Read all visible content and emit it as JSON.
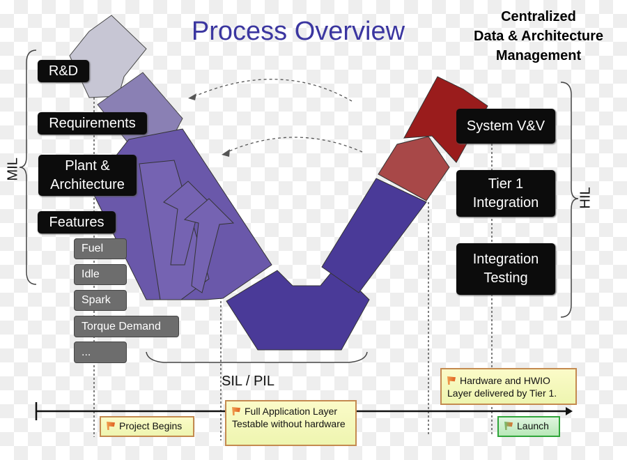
{
  "title": "Process Overview",
  "central_label": [
    "Centralized",
    "Data & Architecture",
    "Management"
  ],
  "left_stages": [
    "R&D",
    "Requirements",
    "Plant & Architecture",
    "Features"
  ],
  "features": [
    "Fuel",
    "Idle",
    "Spark",
    "Torque Demand",
    "..."
  ],
  "right_stages": [
    "System V&V",
    "Tier 1 Integration",
    "Integration Testing"
  ],
  "brackets": {
    "left": "MIL",
    "right": "HIL",
    "bottom": "SIL / PIL"
  },
  "milestones": {
    "project_begins": "Project Begins",
    "full_app": "Full Application Layer Testable without hardware",
    "hardware": "Hardware and HWIO Layer delivered by Tier 1.",
    "launch": "Launch"
  },
  "colors": {
    "title": "#3b36a0",
    "rd": "#c7c6d4",
    "requirements": "#8a80b4",
    "design": "#6a58aa",
    "implementation": "#4a3a98",
    "tier1": "#a84848",
    "system": "#9a1c1c"
  }
}
